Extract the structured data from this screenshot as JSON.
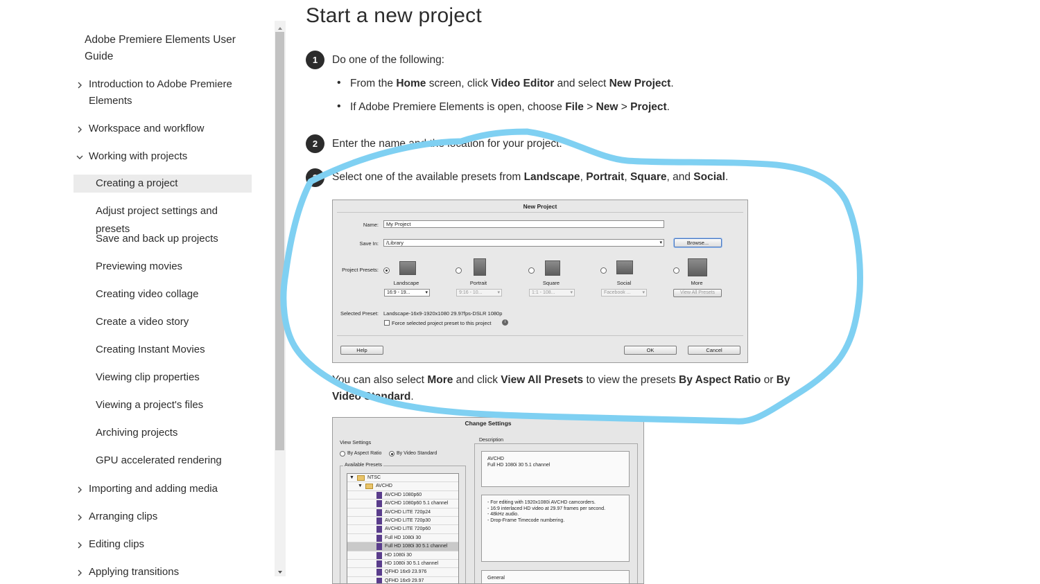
{
  "sidebar": {
    "root": "Adobe Premiere Elements User Guide",
    "items": [
      {
        "label": "Introduction to Adobe Premiere Elements",
        "state": "collapsed"
      },
      {
        "label": "Workspace and workflow",
        "state": "collapsed"
      },
      {
        "label": "Working with projects",
        "state": "expanded"
      }
    ],
    "subitems": [
      "Creating a project",
      "Adjust project settings and presets",
      "Save and back up projects",
      "Previewing movies",
      "Creating video collage",
      "Create a video story",
      "Creating Instant Movies",
      "Viewing clip properties",
      "Viewing a project's files",
      "Archiving projects",
      "GPU accelerated rendering"
    ],
    "active_subitem": "Creating a project",
    "items_after": [
      {
        "label": "Importing and adding media",
        "state": "collapsed"
      },
      {
        "label": "Arranging clips",
        "state": "collapsed"
      },
      {
        "label": "Editing clips",
        "state": "collapsed"
      },
      {
        "label": "Applying transitions",
        "state": "collapsed"
      }
    ]
  },
  "main": {
    "title": "Start a new project",
    "step1": {
      "num": "1",
      "text": "Do one of the following:",
      "bullet1": {
        "a": "From the ",
        "b": "Home",
        "c": " screen, click ",
        "d": "Video Editor",
        "e": " and select ",
        "f": "New Project",
        "g": "."
      },
      "bullet2": {
        "a": "If Adobe Premiere Elements is open, choose ",
        "b": "File",
        "c": " > ",
        "d": "New",
        "e": " > ",
        "f": "Project",
        "g": "."
      }
    },
    "step2": {
      "num": "2",
      "text": "Enter the name and the location for your project."
    },
    "step3": {
      "num": "3",
      "a": "Select one of the available presets from ",
      "b": "Landscape",
      "c": ", ",
      "d": "Portrait",
      "e": ", ",
      "f": "Square",
      "g": ", and ",
      "h": "Social",
      "i": "."
    },
    "note": {
      "a": "You can also select ",
      "b": "More",
      "c": " and click ",
      "d": "View All Presets",
      "e": " to view the presets ",
      "f": "By Aspect Ratio",
      "g": " or ",
      "h": "By Video Standard",
      "i": "."
    }
  },
  "new_project_dialog": {
    "title": "New Project",
    "name_label": "Name:",
    "name_value": "My Project",
    "save_in_label": "Save In:",
    "save_in_value": "/Library",
    "browse": "Browse...",
    "presets_label": "Project Presets:",
    "presets": [
      {
        "name": "Landscape",
        "select": "16:9 - 19...",
        "selected": true,
        "enabled": true
      },
      {
        "name": "Portrait",
        "select": "9:16 - 10...",
        "selected": false,
        "enabled": false
      },
      {
        "name": "Square",
        "select": "1:1 - 108...",
        "selected": false,
        "enabled": false
      },
      {
        "name": "Social",
        "select": "Facebook ...",
        "selected": false,
        "enabled": false
      },
      {
        "name": "More",
        "select": "View All Presets",
        "selected": false,
        "enabled": false
      }
    ],
    "selected_preset_label": "Selected Preset:",
    "selected_preset_value": "Landscape-16x9-1920x1080 29.97fps-DSLR 1080p",
    "force_label": "Force selected project preset to this project",
    "help": "Help",
    "ok": "OK",
    "cancel": "Cancel"
  },
  "change_settings_dialog": {
    "title": "Change Settings",
    "view_settings": "View Settings",
    "by_aspect_ratio": "By Aspect Ratio",
    "by_video_standard": "By Video Standard",
    "available_presets": "Available Presets",
    "description": "Description",
    "tree": [
      {
        "label": "NTSC",
        "type": "folder",
        "level": 0
      },
      {
        "label": "AVCHD",
        "type": "folder",
        "level": 1
      },
      {
        "label": "AVCHD 1080p60",
        "type": "file",
        "level": 2
      },
      {
        "label": "AVCHD 1080p60 5.1 channel",
        "type": "file",
        "level": 2
      },
      {
        "label": "AVCHD LITE 720p24",
        "type": "file",
        "level": 2
      },
      {
        "label": "AVCHD LITE 720p30",
        "type": "file",
        "level": 2
      },
      {
        "label": "AVCHD LITE 720p60",
        "type": "file",
        "level": 2
      },
      {
        "label": "Full HD 1080i 30",
        "type": "file",
        "level": 2
      },
      {
        "label": "Full HD 1080i 30 5.1 channel",
        "type": "file",
        "level": 2,
        "selected": true
      },
      {
        "label": "HD 1080i 30",
        "type": "file",
        "level": 2
      },
      {
        "label": "HD 1080i 30 5.1 channel",
        "type": "file",
        "level": 2
      },
      {
        "label": "QFHD 16x9 23.976",
        "type": "file",
        "level": 2
      },
      {
        "label": "QFHD 16x9 29.97",
        "type": "file",
        "level": 2
      }
    ],
    "desc_title_line1": "AVCHD",
    "desc_title_line2": "Full HD 1080i 30 5.1 channel",
    "desc_lines": [
      "- For editing with 1920x1080i AVCHD camcorders.",
      "- 16:9 interlaced HD video at 29.97 frames per second.",
      "- 48kHz audio.",
      "- Drop-Frame Timecode numbering."
    ],
    "general_label": "General"
  },
  "annotation_color": "#7fd0f2"
}
